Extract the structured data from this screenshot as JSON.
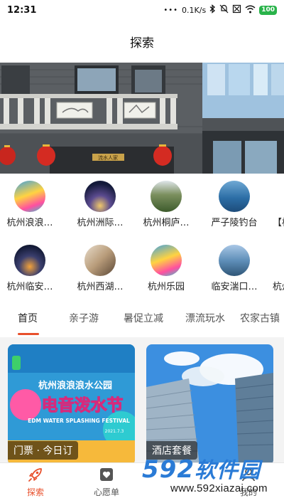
{
  "status_bar": {
    "time": "12:31",
    "dots": "•••",
    "speed": "0.1K/s",
    "battery": "100",
    "icons": [
      "bluetooth-icon",
      "mute-icon",
      "sim-off-icon",
      "wifi-icon",
      "battery-icon"
    ]
  },
  "header": {
    "title": "探索"
  },
  "banner": {
    "sign_text": "流水人家"
  },
  "grid": {
    "row1": [
      {
        "label": "杭州浪浪…",
        "thumb": "water-park"
      },
      {
        "label": "杭州洲际…",
        "thumb": "night-city"
      },
      {
        "label": "杭州桐庐…",
        "thumb": "mountain"
      },
      {
        "label": "严子陵钓台",
        "thumb": "lake"
      },
      {
        "label": "【杭",
        "thumb": "partial"
      }
    ],
    "row2": [
      {
        "label": "杭州临安…",
        "thumb": "night-valley"
      },
      {
        "label": "杭州西湖…",
        "thumb": "hotel-room"
      },
      {
        "label": "杭州乐园",
        "thumb": "water-park"
      },
      {
        "label": "临安湍口…",
        "thumb": "lake-sky"
      },
      {
        "label": "杭州",
        "thumb": "partial"
      }
    ]
  },
  "tabs": [
    {
      "label": "首页",
      "active": true
    },
    {
      "label": "亲子游",
      "active": false
    },
    {
      "label": "暑促立减",
      "active": false
    },
    {
      "label": "漂流玩水",
      "active": false
    },
    {
      "label": "农家古镇",
      "active": false
    }
  ],
  "cards": [
    {
      "label": "门票 · 今日订",
      "poster_title": "杭州浪浪浪水公园",
      "poster_main": "电音泼水节",
      "poster_sub": "EDM WATER SPLASHING FESTIVAL",
      "poster_date": "2021.7.3"
    },
    {
      "label": "酒店套餐"
    }
  ],
  "bottom_nav": [
    {
      "label": "探索",
      "icon": "rocket-icon",
      "active": true
    },
    {
      "label": "心愿单",
      "icon": "heart-card-icon",
      "active": false
    },
    {
      "label": "",
      "icon": "",
      "active": false
    },
    {
      "label": "",
      "icon": "",
      "active": false
    },
    {
      "label": "我的",
      "icon": "user-icon",
      "active": false
    }
  ],
  "watermark": {
    "logo_num": "592",
    "logo_cn": "软件园",
    "url": "www.592xiazai.com"
  },
  "colors": {
    "accent": "#e8502c",
    "battery": "#29b34a",
    "watermark_blue": "#2a7bd6",
    "watermark_orange": "#f08a1a"
  }
}
